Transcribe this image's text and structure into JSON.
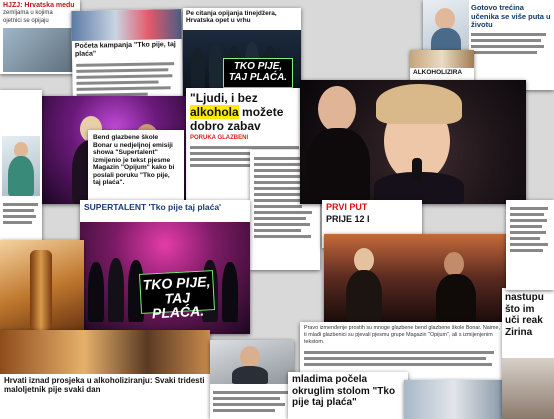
{
  "clips": {
    "top_left": {
      "headline": "HJZJ: Hrvatska medu",
      "sub1": "zemljama u kojima",
      "sub2": "ojetnici se opijaju"
    },
    "top_campaign": {
      "headline": "Početa kampanja \"Tko pije, taj plaća\""
    },
    "top_center": {
      "headline": "Pe citanja opijanja tinejdžera, Hrvatska opet u vrhu"
    },
    "top_right": {
      "headline": "Gotovo trećina učenika se više puta u životu"
    },
    "small_right": {
      "text": "ALKOHOLIZIRA"
    },
    "main_quote": {
      "headline_part1": "\"Ljudi, i bez ",
      "headline_highlight": "alkohola",
      "headline_part2": " možete dobro zabav",
      "kicker": "PORUKA GLAZBENI",
      "body": "Bend glazbene škole Bonar u nedjeljnoj emisiji showa \"Supertalent\" izmijenio je tekst pjesme Magazin \"Opijum\" kako bi poslali poruku \"Tko pije, taj plaća\"."
    },
    "supertalent": {
      "headline": "SUPERTALENT 'Tko pije taj plaća'"
    },
    "banner_stage": {
      "line1": "TKO PIJE,",
      "line2": "TAJ PLAĆA."
    },
    "banner_top": {
      "line1": "TKO PIJE,",
      "line2": "TAJ PLAĆA."
    },
    "mid_right": {
      "headline": "PRVI PUT",
      "sub": "PRIJE 12 I"
    },
    "bottom_left": {
      "headline": "Hrvati iznad prosjeka u alkoholiziranju: Svaki tridesti maloljetnik pije svaki dan"
    },
    "bottom_center": {
      "headline": "mladima počela okruglim stolom \"Tko pije taj plaća\""
    },
    "bottom_right": {
      "headline": "nastupu što im uči reak Zirina"
    },
    "article_text": {
      "text": "Pravo izmenđenje prostih su mnoge glazbene bend glazbene škole Bonar. Naime, ti mlađi glazbenici su pjevali pjesmu grupe Magazin \"Opijum\", ali s izmijenjenim tekstom."
    }
  }
}
